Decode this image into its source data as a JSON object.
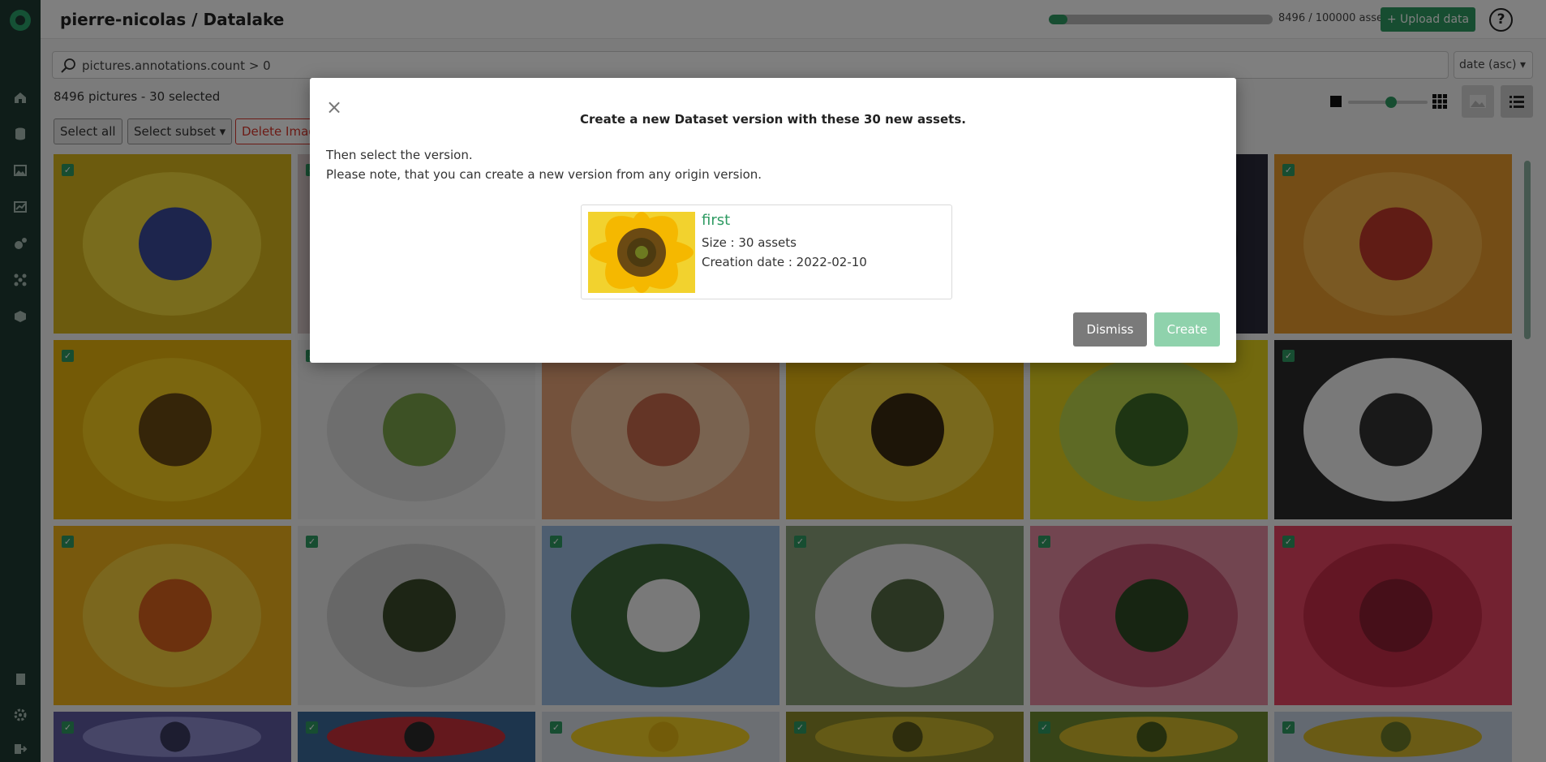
{
  "header": {
    "title": "pierre-nicolas / Datalake",
    "quota_text": "8496 / 100000 assets",
    "quota_fraction": 0.085,
    "upload_label": "+ Upload data",
    "help_label": "?"
  },
  "search": {
    "query": "pictures.annotations.count > 0",
    "sort_label": "date (asc)"
  },
  "toolbar": {
    "count_text": "8496 pictures - 30 selected",
    "select_all_label": "Select all",
    "select_subset_label": "Select subset",
    "delete_label": "Delete Imag"
  },
  "grid": {
    "check_mark": "✓"
  },
  "sidebar": {
    "icons": [
      "home-icon",
      "database-icon",
      "image-icon",
      "chart-icon",
      "robot-icon",
      "network-icon",
      "cube-icon",
      "document-icon",
      "settings-icon",
      "logout-icon"
    ]
  },
  "modal": {
    "close_label": "×",
    "title": "Create a new Dataset version with these 30 new assets.",
    "line1": "Then select the version.",
    "line2": "Please note, that you can create a new version from any origin version.",
    "version": {
      "name": "first",
      "size": "Size : 30 assets",
      "created": "Creation date : 2022-02-10"
    },
    "dismiss_label": "Dismiss",
    "create_label": "Create"
  },
  "colors": {
    "accent": "#2f9b63",
    "sidebar": "#1f3a32",
    "danger": "#d9372d"
  }
}
